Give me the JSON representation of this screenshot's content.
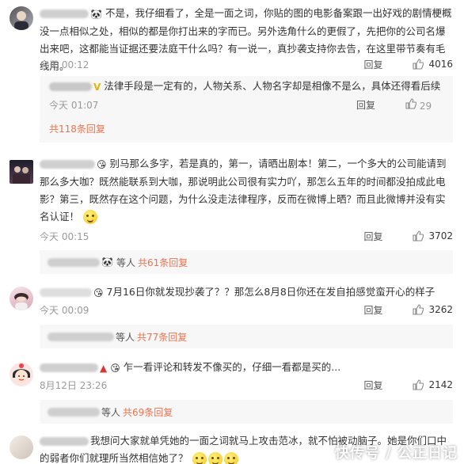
{
  "comments": [
    {
      "text": "不是，我仔细看了，全是一面之词，你贴的图的电影备案跟一出好戏的剧情梗概没一点相似之处，相似的都是你打出来的字而已。另外选角什么的更假了，先把你的公司名爆出来吧，这都能当证据还要法庭干什么吗？有一说一，真抄袭支持你去告，在这里带节奏有毛线用。",
      "time": "今天 00:12",
      "reply": "回复",
      "likes": "4016",
      "subreply": {
        "text": "法律手段是一定有的，人物关系、人物名字却是相像不是么，具体还得看后续",
        "time": "今天 01:07",
        "reply": "回复",
        "likes": "29",
        "more": "共118条回复"
      }
    },
    {
      "text": "别马那么多字，若是真的，第一，请晒出剧本！第二，一个多大的公司能请到那么多大咖？既然能联系到大咖，那说明此公司很有实力吖，那怎么五年的时间都没拍成此电影？第三，既然存在这个问题，为什么没走法律程序，反而在微博上晒？而且此微博并没有实名认证！",
      "time": "今天 00:15",
      "reply": "回复",
      "likes": "3702",
      "bar_prefix": "等人",
      "bar_count": "共61条回复"
    },
    {
      "text": "7月16日你就发现抄袭了？？那怎么8月8日你还在发自拍感觉蛮开心的样子",
      "time": "今天 00:09",
      "reply": "回复",
      "likes": "3262",
      "bar_prefix": "等人",
      "bar_count": "共77条回复"
    },
    {
      "text": "乍一看评论和转发不像买的，仔细一看都是买的...",
      "time": "8月12日 23:26",
      "reply": "回复",
      "likes": "2142",
      "bar_prefix": "等人",
      "bar_count": "共69条回复"
    },
    {
      "text": "我想问大家就单凭她的一面之词就马上攻击范冰，就不怕被动脑子。她是你们口中的弱者你们就理所当然相信她了？"
    }
  ],
  "watermark": "快传号 / 公正日记",
  "colors": {
    "accent": "#eb7350",
    "bg_sub": "#f7f7f7"
  },
  "icons": [
    "panda-emoji-icon",
    "thumb-up-icon",
    "smile-emoji-icon",
    "avatar-icon"
  ]
}
